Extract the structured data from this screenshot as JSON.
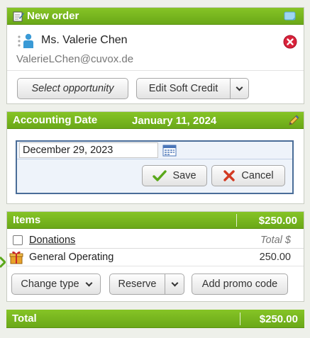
{
  "order": {
    "title": "New order",
    "contact_name": "Ms. Valerie Chen",
    "contact_email": "ValerieLChen@cuvox.de",
    "select_opportunity_label": "Select opportunity",
    "edit_soft_credit_label": "Edit Soft Credit"
  },
  "accounting": {
    "title": "Accounting Date",
    "date_display": "January 11, 2024",
    "date_input_value": "December 29, 2023",
    "save_label": "Save",
    "cancel_label": "Cancel"
  },
  "items": {
    "title": "Items",
    "total": "$250.00",
    "group_label": "Donations",
    "group_col_header": "Total $",
    "row_name": "General Operating",
    "row_amount": "250.00",
    "change_type_label": "Change type",
    "reserve_label": "Reserve",
    "add_promo_label": "Add promo code"
  },
  "total": {
    "label": "Total",
    "amount": "$250.00"
  },
  "colors": {
    "header_green": "#6aa818",
    "remove_red": "#d9223a",
    "link_blue": "#1a4f8a"
  }
}
